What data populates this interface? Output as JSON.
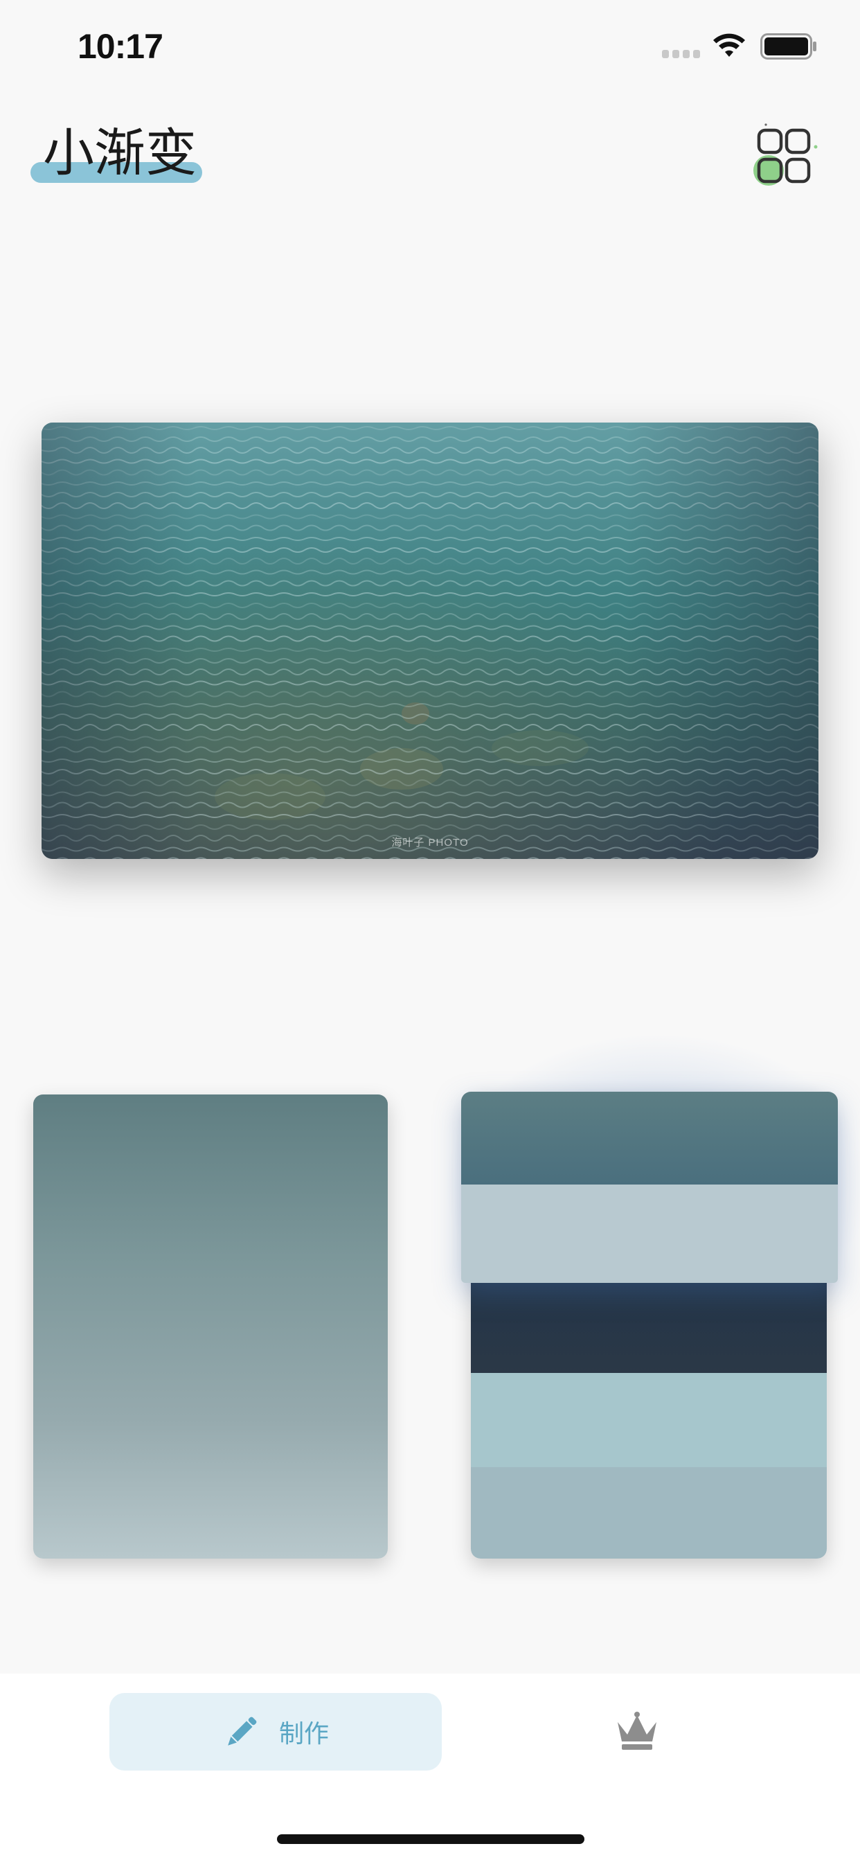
{
  "status_bar": {
    "time": "10:17",
    "icons": [
      "signal-icon",
      "wifi-icon",
      "battery-icon"
    ]
  },
  "header": {
    "title": "小渐变",
    "accent_color": "#8bc4d8",
    "menu_icon": "apps-grid-icon"
  },
  "hero": {
    "watermark": "海叶子 PHOTO",
    "subject": "sea water surface"
  },
  "gradient_card": {
    "colors": [
      "#5f7e82",
      "#7c979a",
      "#96aaae",
      "#b8c8cc"
    ]
  },
  "palette": {
    "swatches": [
      "#5a7f86",
      "#b8c9d0",
      "#253447",
      "#a6c6cc",
      "#a0b9c1"
    ]
  },
  "tabbar": {
    "make_label": "制作",
    "make_icon": "pencil-icon",
    "premium_icon": "crown-icon",
    "active_color": "#5aa6c4"
  }
}
